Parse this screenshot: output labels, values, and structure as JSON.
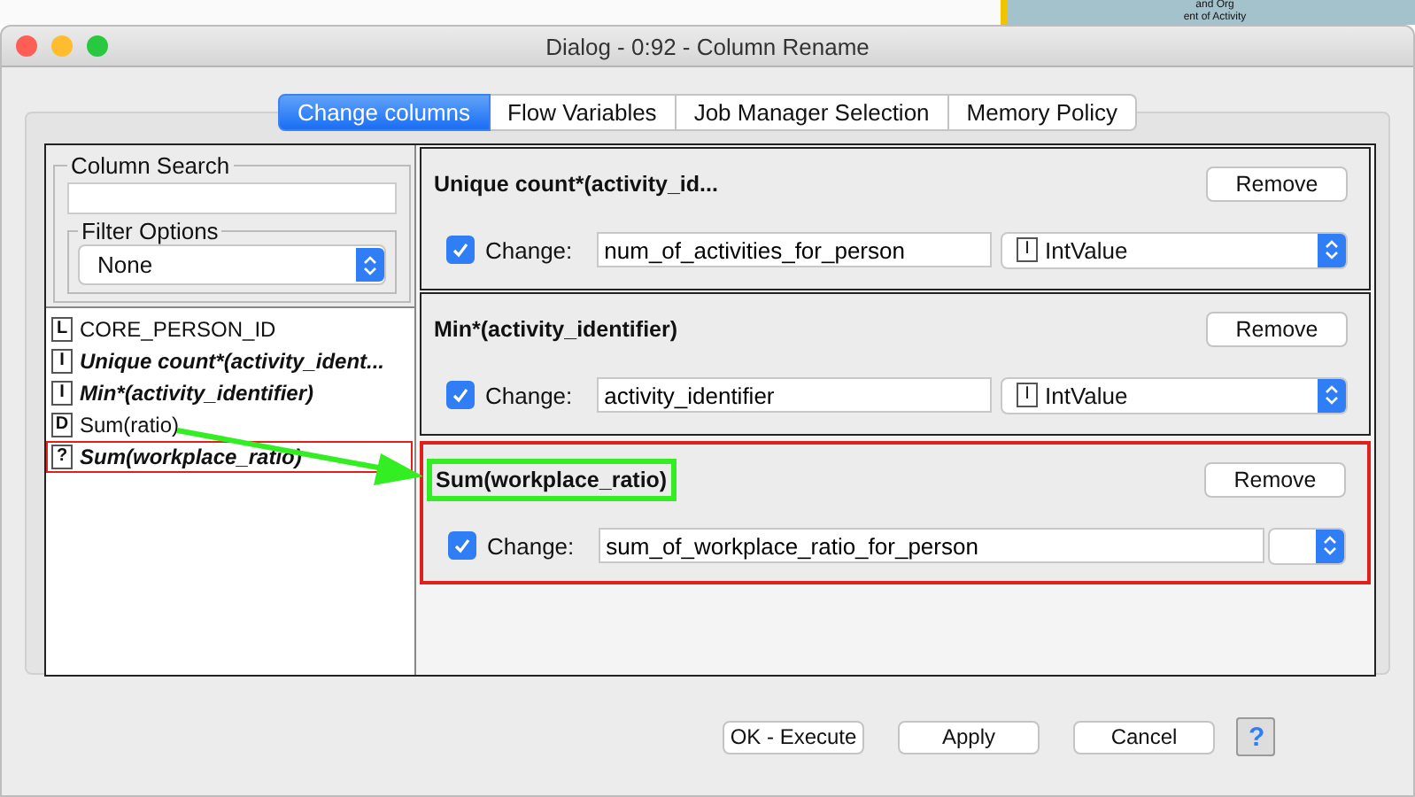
{
  "background_node": {
    "lines": [
      "and Org",
      "ent of Activity"
    ]
  },
  "window": {
    "title": "Dialog - 0:92 - Column Rename"
  },
  "tabs": [
    {
      "label": "Change columns",
      "selected": true
    },
    {
      "label": "Flow Variables",
      "selected": false
    },
    {
      "label": "Job Manager Selection",
      "selected": false
    },
    {
      "label": "Memory Policy",
      "selected": false
    }
  ],
  "column_search": {
    "label": "Column Search"
  },
  "filter_options": {
    "label": "Filter Options",
    "value": "None"
  },
  "columns": [
    {
      "type": "L",
      "name": "CORE_PERSON_ID",
      "kind": "plain",
      "highlighted": false
    },
    {
      "type": "I",
      "name": "Unique count*(activity_ident...",
      "kind": "bold-italic",
      "highlighted": false
    },
    {
      "type": "I",
      "name": "Min*(activity_identifier)",
      "kind": "bold-italic",
      "highlighted": false
    },
    {
      "type": "D",
      "name": "Sum(ratio)",
      "kind": "plain",
      "highlighted": false
    },
    {
      "type": "?",
      "name": "Sum(workplace_ratio)",
      "kind": "bold-italic",
      "highlighted": true
    }
  ],
  "rename_cards": [
    {
      "title": "Unique count*(activity_id...",
      "remove": "Remove",
      "checked": true,
      "change_label": "Change:",
      "new_name": "num_of_activities_for_person",
      "type_icon": "I",
      "type": "IntValue",
      "highlighted": false,
      "title_highlighted": false
    },
    {
      "title": "Min*(activity_identifier)",
      "remove": "Remove",
      "checked": true,
      "change_label": "Change:",
      "new_name": "activity_identifier",
      "type_icon": "I",
      "type": "IntValue",
      "highlighted": false,
      "title_highlighted": false
    },
    {
      "title": "Sum(workplace_ratio)",
      "remove": "Remove",
      "checked": true,
      "change_label": "Change:",
      "new_name": "sum_of_workplace_ratio_for_person",
      "highlighted": true,
      "title_highlighted": true
    }
  ],
  "buttons": [
    {
      "label": "OK - Execute"
    },
    {
      "label": "Apply"
    },
    {
      "label": "Cancel"
    }
  ],
  "help_button": {
    "label": "?"
  }
}
